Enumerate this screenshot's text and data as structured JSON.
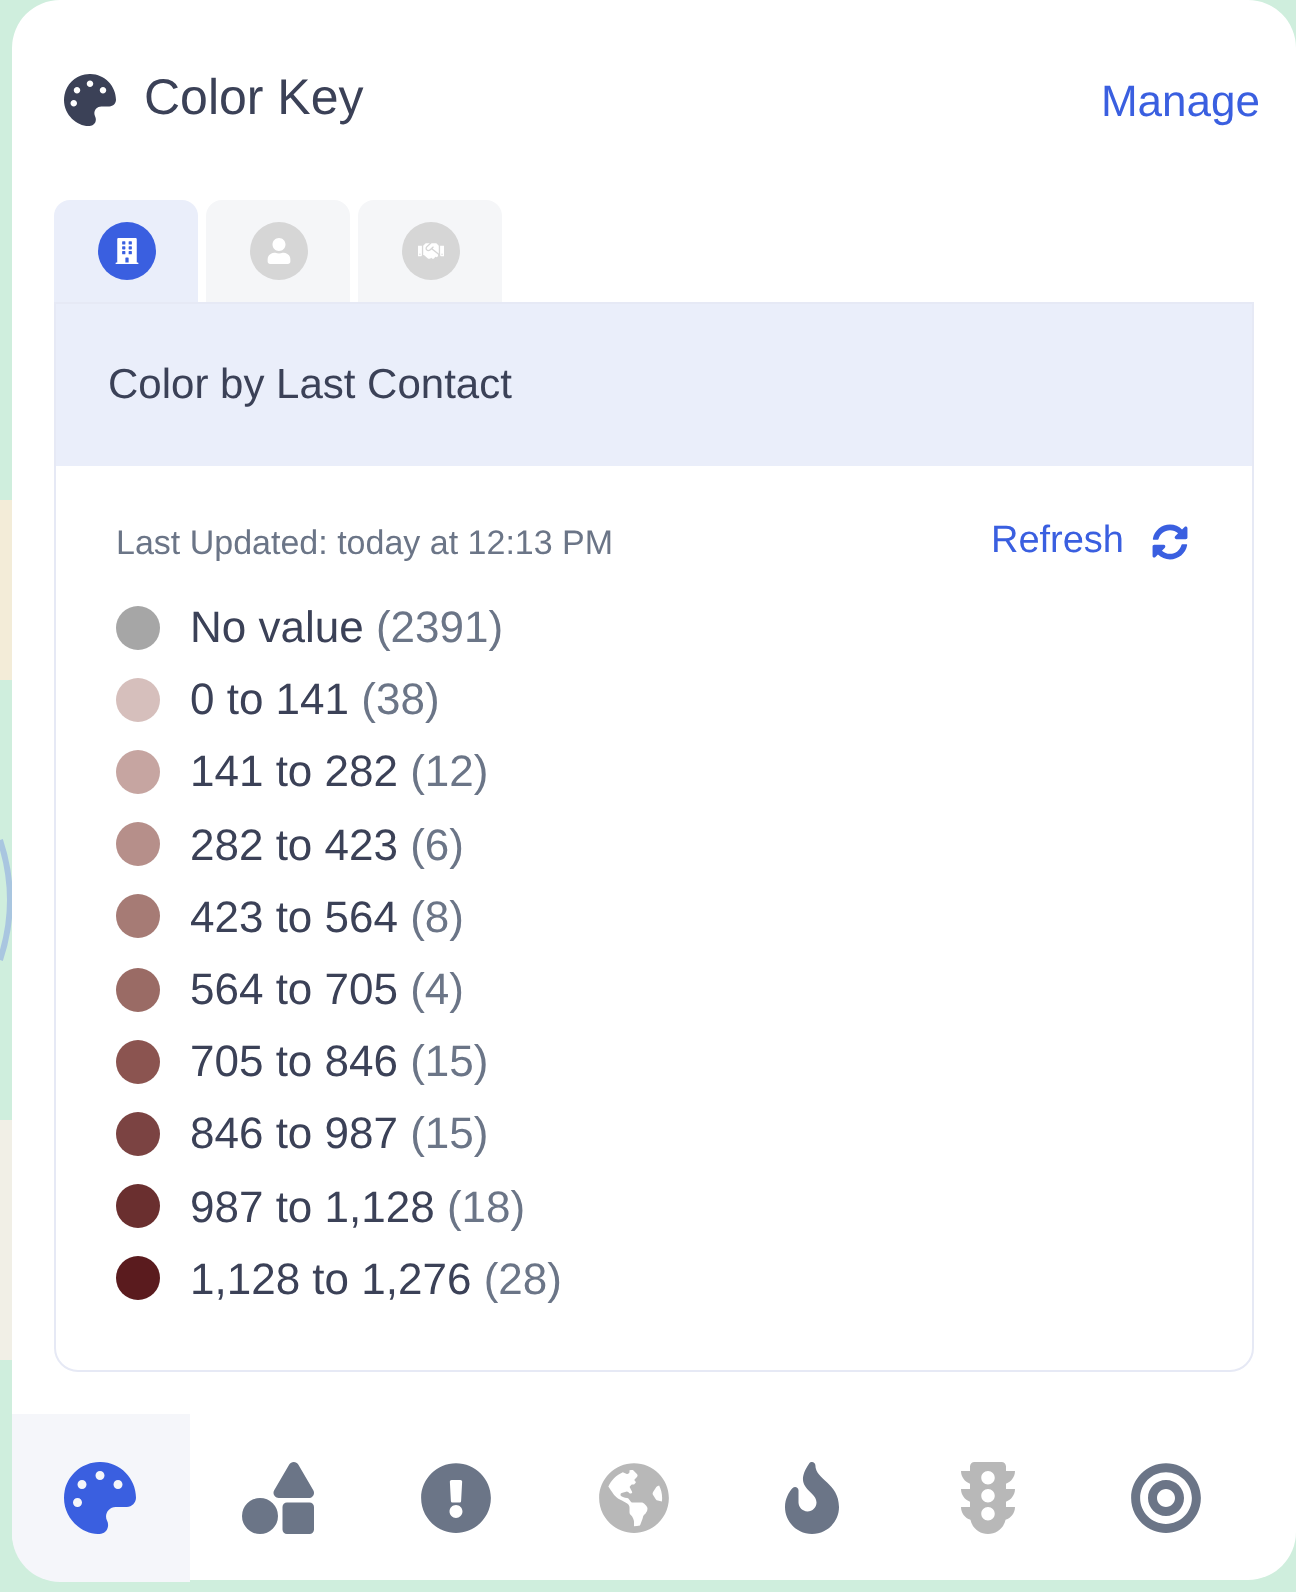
{
  "header": {
    "title": "Color Key",
    "action": "Manage"
  },
  "tabs": [
    {
      "selected": true
    },
    {
      "selected": false
    },
    {
      "selected": false
    }
  ],
  "panel": {
    "title": "Color by Last Contact",
    "updated": "Last Updated: today at 12:13 PM",
    "refresh": "Refresh"
  },
  "legend": [
    {
      "label": "No value",
      "count": "(2391)",
      "color": "#a6a6a6"
    },
    {
      "label": "0 to 141",
      "count": "(38)",
      "color": "#d6bfbc"
    },
    {
      "label": "141 to 282",
      "count": "(12)",
      "color": "#c6a5a1"
    },
    {
      "label": "282 to 423",
      "count": "(6)",
      "color": "#b68f8a"
    },
    {
      "label": "423 to 564",
      "count": "(8)",
      "color": "#a67b75"
    },
    {
      "label": "564 to 705",
      "count": "(4)",
      "color": "#9a6b65"
    },
    {
      "label": "705 to 846",
      "count": "(15)",
      "color": "#8b5450"
    },
    {
      "label": "846 to 987",
      "count": "(15)",
      "color": "#7b4342"
    },
    {
      "label": "987 to 1,128",
      "count": "(18)",
      "color": "#6a2f2f"
    },
    {
      "label": "1,128 to 1,276",
      "count": "(28)",
      "color": "#5a1b1e"
    }
  ],
  "toolbar": [
    {
      "selected": true,
      "disabled": false
    },
    {
      "selected": false,
      "disabled": false
    },
    {
      "selected": false,
      "disabled": false
    },
    {
      "selected": false,
      "disabled": true
    },
    {
      "selected": false,
      "disabled": false
    },
    {
      "selected": false,
      "disabled": true
    },
    {
      "selected": false,
      "disabled": false
    }
  ]
}
